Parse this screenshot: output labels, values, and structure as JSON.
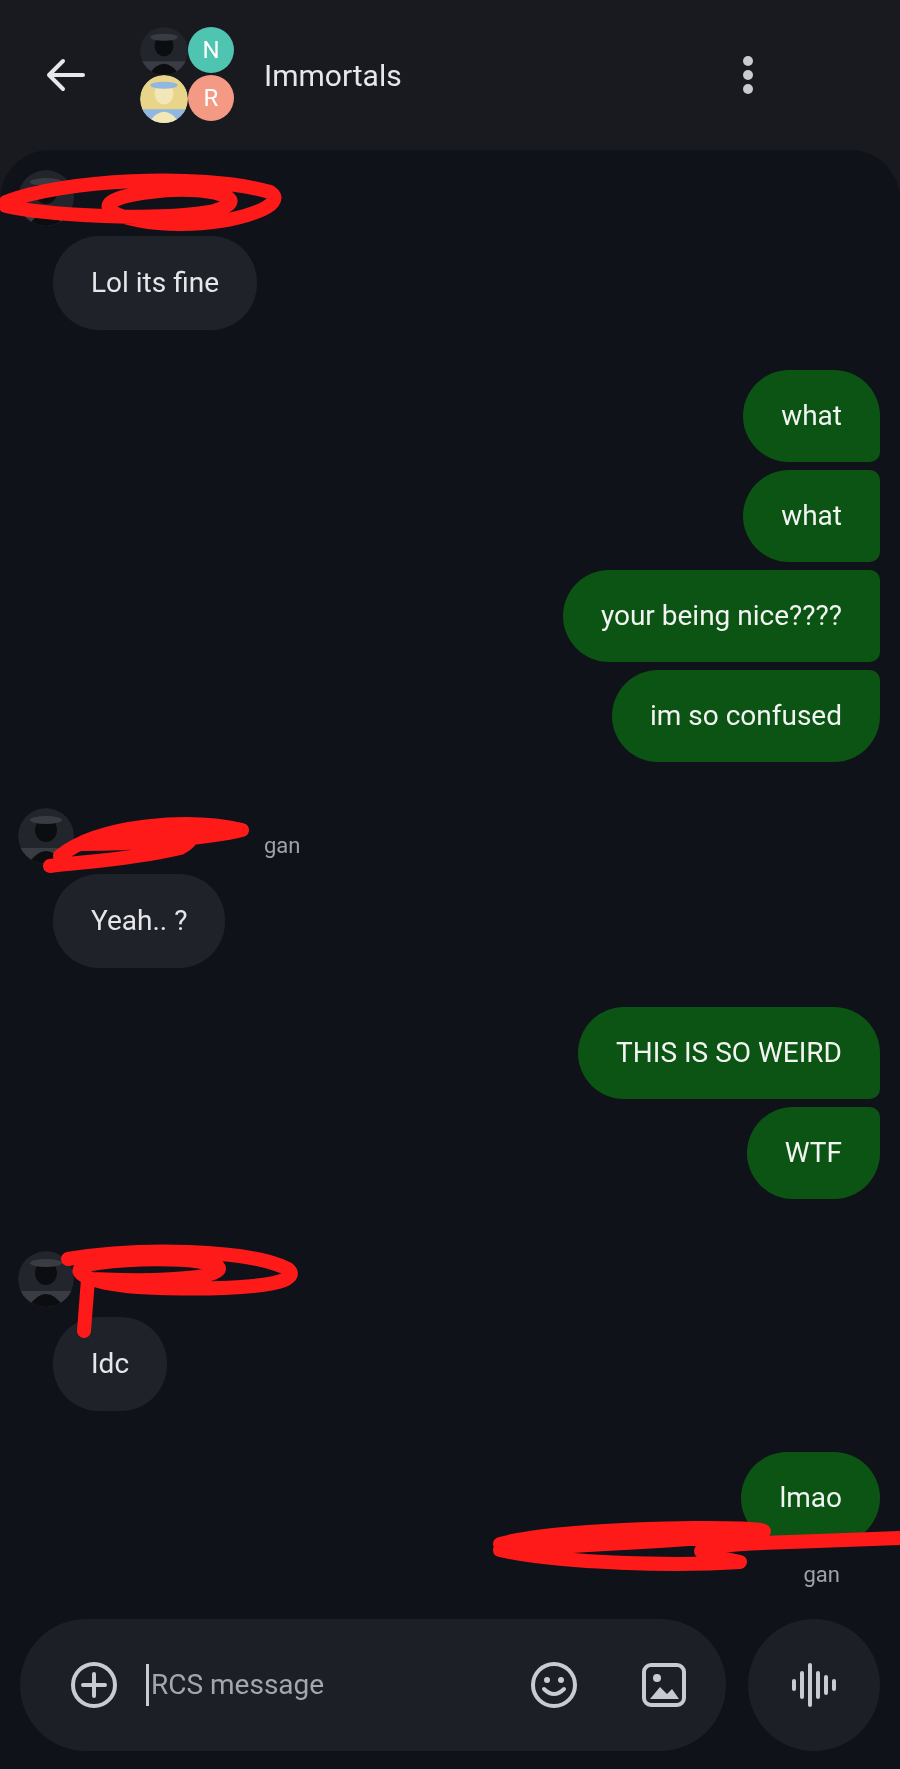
{
  "header": {
    "title": "Immortals",
    "members": [
      {
        "kind": "picture"
      },
      {
        "kind": "letter",
        "letter": "N",
        "color": "#4fc4b0"
      },
      {
        "kind": "picture"
      },
      {
        "kind": "letter",
        "letter": "R",
        "color": "#f49a84"
      }
    ]
  },
  "messages": [
    {
      "kind": "received",
      "redacted": true,
      "texts": [
        "Lol its fine"
      ]
    },
    {
      "kind": "sent",
      "texts": [
        "what",
        "what",
        "your being nice????",
        "im so confused"
      ]
    },
    {
      "kind": "received",
      "redacted": true,
      "sender_name": "gan",
      "texts": [
        "Yeah.. ?"
      ]
    },
    {
      "kind": "sent",
      "texts": [
        "THIS IS SO WEIRD",
        "WTF"
      ]
    },
    {
      "kind": "received",
      "redacted": true,
      "texts": [
        "Idc"
      ]
    },
    {
      "kind": "sent",
      "texts": [
        "lmao"
      ]
    }
  ],
  "receipt": {
    "text": "gan",
    "redacted": true
  },
  "composer": {
    "placeholder": "RCS message"
  }
}
